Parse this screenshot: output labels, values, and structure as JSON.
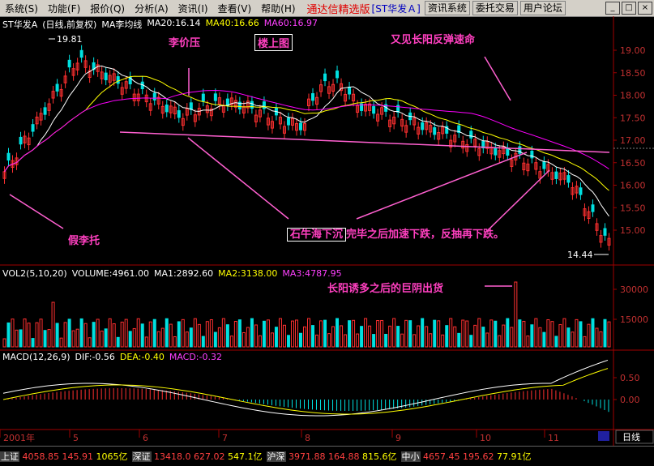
{
  "menu": [
    "系统(S)",
    "功能(F)",
    "报价(Q)",
    "分析(A)",
    "资讯(I)",
    "查看(V)",
    "帮助(H)"
  ],
  "brand": "通达信精选版",
  "stock_tag": "[ST华发Ａ]",
  "toolbar_buttons": [
    "资讯系统",
    "委托交易",
    "用户论坛"
  ],
  "window_controls": [
    "_",
    "□",
    "×"
  ],
  "main_legend": {
    "name": "ST华发A",
    "mode": "(日线,前复权)",
    "indicator": "MA李均线",
    "ma20": "MA20:16.14",
    "ma40": "MA40:16.66",
    "ma60": "MA60:16.97"
  },
  "price_axis": [
    "19.00",
    "18.50",
    "18.00",
    "17.50",
    "17.00",
    "16.50",
    "16.00",
    "15.50",
    "15.00"
  ],
  "high_label": "19.81",
  "low_label": "14.44",
  "vol_legend": {
    "title": "VOL2(5,10,20)",
    "volume": "VOLUME:4961.00",
    "ma1": "MA1:2892.60",
    "ma2": "MA2:3138.00",
    "ma3": "MA3:4787.95"
  },
  "vol_axis": [
    "30000",
    "15000"
  ],
  "macd_legend": {
    "title": "MACD(12,26,9)",
    "dif": "DIF:-0.56",
    "dea": "DEA:-0.40",
    "macd": "MACD:-0.32"
  },
  "macd_axis": [
    "0.50",
    "0.00"
  ],
  "date_axis": [
    "2001年",
    "5",
    "6",
    "7",
    "8",
    "9",
    "10",
    "11"
  ],
  "period_button": "日线",
  "annotations": {
    "li_price": "李价压",
    "building": "楼上图",
    "youjian": "又见长阳反弹速命",
    "jia_li": "假李托",
    "shi_niu": "石牛海下沉",
    "shi_niu_rest": "完毕之后加速下跌，反抽再下跌。",
    "chang_yang": "长阳诱多之后的巨阴出货"
  },
  "status": [
    {
      "name": "上证",
      "v1": "4058.85",
      "v2": "145.91",
      "v3": "1065亿"
    },
    {
      "name": "深证",
      "v1": "13418.0",
      "v2": "627.02",
      "v3": "547.1亿"
    },
    {
      "name": "沪深",
      "v1": "3971.88",
      "v2": "164.88",
      "v3": "815.6亿"
    },
    {
      "name": "中小",
      "v1": "4657.45",
      "v2": "195.62",
      "v3": "77.91亿"
    }
  ],
  "colors": {
    "up": "#ff3030",
    "down": "#00e0e0",
    "ma20": "#ffffff",
    "ma40": "#ffff00",
    "ma60": "#ff00ff",
    "annotation": "#ff40c0"
  }
}
